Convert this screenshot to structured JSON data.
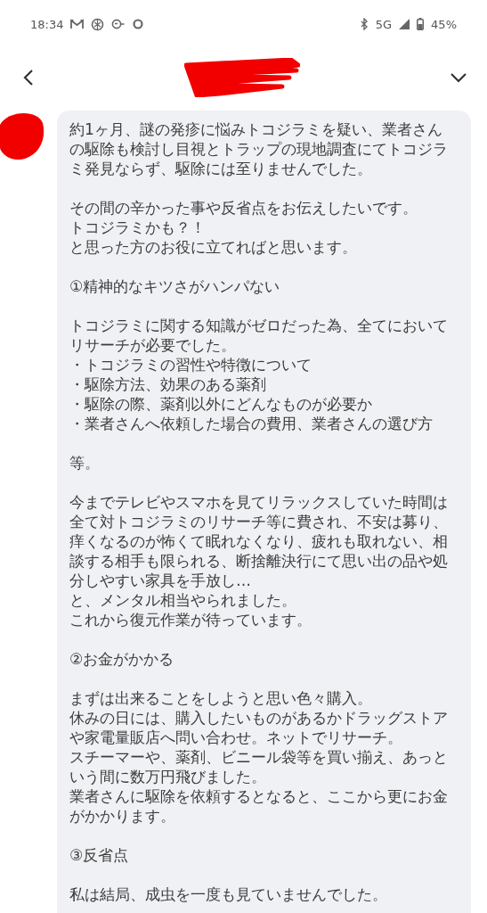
{
  "status_bar": {
    "time": "18:34",
    "network": "5G",
    "battery": "45%"
  },
  "header": {
    "kind": "redacted"
  },
  "message": {
    "paragraphs": [
      {
        "lines": [
          "約1ヶ月、謎の発疹に悩みトコジラミを疑い、業者さんの駆除も検討し目視とトラップの現地調査にてトコジラミ発見ならず、駆除には至りませんでした。"
        ]
      },
      {
        "lines": [
          "その間の辛かった事や反省点をお伝えしたいです。",
          "トコジラミかも？！",
          "と思った方のお役に立てればと思います。"
        ]
      },
      {
        "lines": [
          "①精神的なキツさがハンパない"
        ]
      },
      {
        "lines": [
          "トコジラミに関する知識がゼロだった為、全てにおいてリサーチが必要でした。",
          "・トコジラミの習性や特徴について",
          "・駆除方法、効果のある薬剤",
          "・駆除の際、薬剤以外にどんなものが必要か",
          "・業者さんへ依頼した場合の費用、業者さんの選び方"
        ]
      },
      {
        "lines": [
          "等。"
        ]
      },
      {
        "lines": [
          "今までテレビやスマホを見てリラックスしていた時間は全て対トコジラミのリサーチ等に費され、不安は募り、痒くなるのが怖くて眠れなくなり、疲れも取れない、相談する相手も限られる、断捨離決行にて思い出の品や処分しやすい家具を手放し…",
          "と、メンタル相当やられました。",
          "これから復元作業が待っています。"
        ]
      },
      {
        "lines": [
          "②お金がかかる"
        ]
      },
      {
        "lines": [
          "まずは出来ることをしようと思い色々購入。",
          "休みの日には、購入したいものがあるかドラッグストアや家電量販店へ問い合わせ。ネットでリサーチ。",
          "スチーマーや、薬剤、ビニール袋等を買い揃え、あっという間に数万円飛びました。",
          "業者さんに駆除を依頼するとなると、ここから更にお金がかかります。"
        ]
      },
      {
        "lines": [
          "③反省点"
        ]
      },
      {
        "lines": [
          "私は結局、成虫を一度も見ていませんでした。"
        ]
      }
    ]
  }
}
